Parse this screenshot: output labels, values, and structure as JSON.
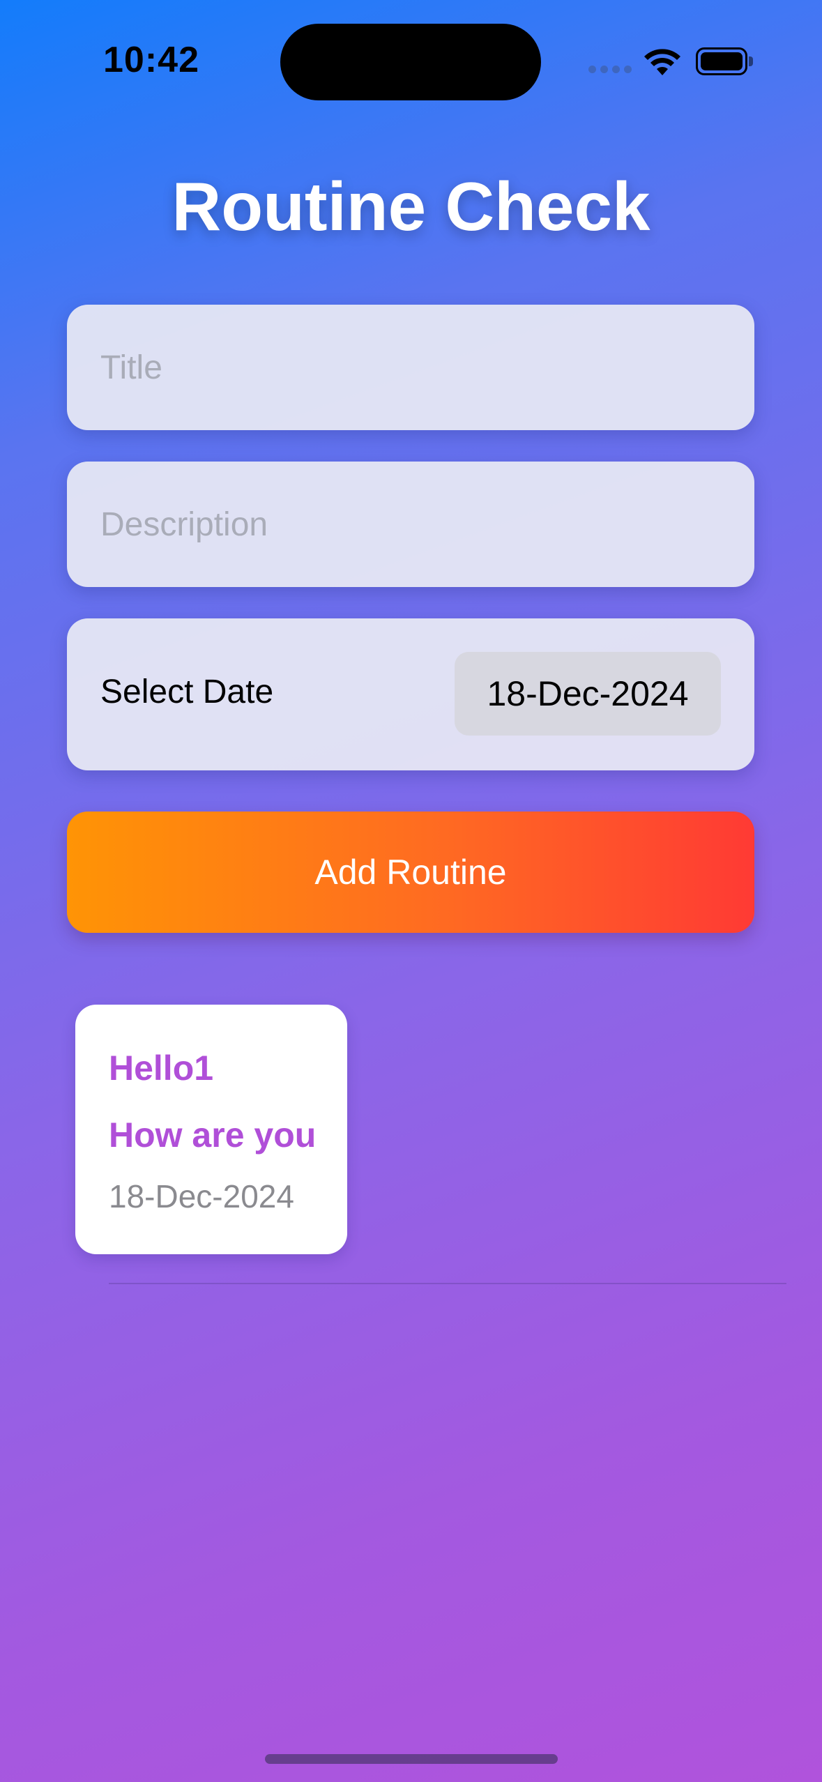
{
  "status_bar": {
    "time": "10:42",
    "icons": [
      "cellular-signal-icon",
      "wifi-icon",
      "battery-icon"
    ]
  },
  "app": {
    "title": "Routine Check"
  },
  "form": {
    "title_placeholder": "Title",
    "title_value": "",
    "description_placeholder": "Description",
    "description_value": "",
    "date_label": "Select Date",
    "date_value": "18-Dec-2024",
    "add_button_label": "Add Routine"
  },
  "routines": [
    {
      "title": "Hello1",
      "description": "How are you",
      "date": "18-Dec-2024"
    }
  ],
  "colors": {
    "gradient_top": "#137cfb",
    "gradient_bottom": "#b053dc",
    "button_start": "#ff9405",
    "button_end": "#ff3a34",
    "card_accent": "#b04fd8"
  }
}
